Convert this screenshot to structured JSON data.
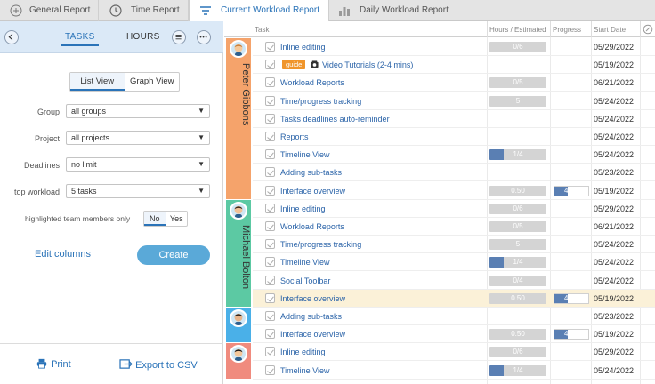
{
  "tabs": [
    {
      "label": "General Report",
      "icon": "grid-icon"
    },
    {
      "label": "Time Report",
      "icon": "clock-icon"
    },
    {
      "label": "Current Workload Report",
      "icon": "workload-icon"
    },
    {
      "label": "Daily Workload Report",
      "icon": "bar-chart-icon"
    }
  ],
  "left": {
    "tasks_label": "TASKS",
    "hours_label": "HOURS",
    "list_view": "List View",
    "graph_view": "Graph View",
    "filters": [
      {
        "label": "Group",
        "value": "all groups"
      },
      {
        "label": "Project",
        "value": "all projects"
      },
      {
        "label": "Deadlines",
        "value": "no limit"
      },
      {
        "label": "top workload",
        "value": "5 tasks"
      }
    ],
    "highlight_label": "highlighted team members only",
    "no_label": "No",
    "yes_label": "Yes",
    "edit_columns": "Edit columns",
    "create": "Create",
    "print": "Print",
    "export": "Export to CSV"
  },
  "grid": {
    "columns": {
      "task": "Task",
      "hours": "Hours / Estimated",
      "progress": "Progress",
      "start": "Start Date"
    },
    "groups": [
      {
        "name": "Peter Gibbons",
        "color": "#f5a36b",
        "rows": [
          {
            "task": "Inline editing",
            "hours": "0/6",
            "hfill": 0,
            "progress": "",
            "pfill": 0,
            "date": "05/29/2022"
          },
          {
            "task": "Video Tutorials (2-4 mins)",
            "badge": "guide",
            "hours": "",
            "hfill": 0,
            "progress": "",
            "pfill": 0,
            "date": "05/19/2022"
          },
          {
            "task": "Workload Reports",
            "hours": "0/5",
            "hfill": 0,
            "progress": "",
            "pfill": 0,
            "date": "06/21/2022"
          },
          {
            "task": "Time/progress tracking",
            "hours": "5",
            "hfill": 0,
            "progress": "",
            "pfill": 0,
            "date": "05/24/2022"
          },
          {
            "task": "Tasks deadlines auto-reminder",
            "hours": "",
            "hfill": 0,
            "progress": "",
            "pfill": 0,
            "date": "05/24/2022"
          },
          {
            "task": "Reports",
            "hours": "",
            "hfill": 0,
            "progress": "",
            "pfill": 0,
            "date": "05/24/2022"
          },
          {
            "task": "Timeline View",
            "hours": "1/4",
            "hfill": 0.25,
            "progress": "",
            "pfill": 0,
            "date": "05/24/2022"
          },
          {
            "task": "Adding sub-tasks",
            "hours": "",
            "hfill": 0,
            "progress": "",
            "pfill": 0,
            "date": "05/23/2022"
          },
          {
            "task": "Interface overview",
            "hours": "0.50",
            "hfill": 0,
            "progress": "40%",
            "pfill": 0.4,
            "date": "05/19/2022"
          }
        ]
      },
      {
        "name": "Michael Bolton",
        "color": "#5cc9a3",
        "rows": [
          {
            "task": "Inline editing",
            "hours": "0/6",
            "hfill": 0,
            "progress": "",
            "pfill": 0,
            "date": "05/29/2022"
          },
          {
            "task": "Workload Reports",
            "hours": "0/5",
            "hfill": 0,
            "progress": "",
            "pfill": 0,
            "date": "06/21/2022"
          },
          {
            "task": "Time/progress tracking",
            "hours": "5",
            "hfill": 0,
            "progress": "",
            "pfill": 0,
            "date": "05/24/2022"
          },
          {
            "task": "Timeline View",
            "hours": "1/4",
            "hfill": 0.25,
            "progress": "",
            "pfill": 0,
            "date": "05/24/2022"
          },
          {
            "task": "Social Toolbar",
            "hours": "0/4",
            "hfill": 0,
            "progress": "",
            "pfill": 0,
            "date": "05/24/2022"
          },
          {
            "task": "Interface overview",
            "hours": "0.50",
            "hfill": 0,
            "progress": "40%",
            "pfill": 0.4,
            "date": "05/19/2022",
            "highlight": true
          }
        ]
      },
      {
        "name": "",
        "color": "#4ab0e8",
        "rows": [
          {
            "task": "Adding sub-tasks",
            "hours": "",
            "hfill": 0,
            "progress": "",
            "pfill": 0,
            "date": "05/23/2022"
          },
          {
            "task": "Interface overview",
            "hours": "0.50",
            "hfill": 0,
            "progress": "40%",
            "pfill": 0.4,
            "date": "05/19/2022"
          }
        ]
      },
      {
        "name": "",
        "color": "#f08b7e",
        "rows": [
          {
            "task": "Inline editing",
            "hours": "0/6",
            "hfill": 0,
            "progress": "",
            "pfill": 0,
            "date": "05/29/2022"
          },
          {
            "task": "Timeline View",
            "hours": "1/4",
            "hfill": 0.25,
            "progress": "",
            "pfill": 0,
            "date": "05/24/2022"
          }
        ]
      }
    ]
  }
}
